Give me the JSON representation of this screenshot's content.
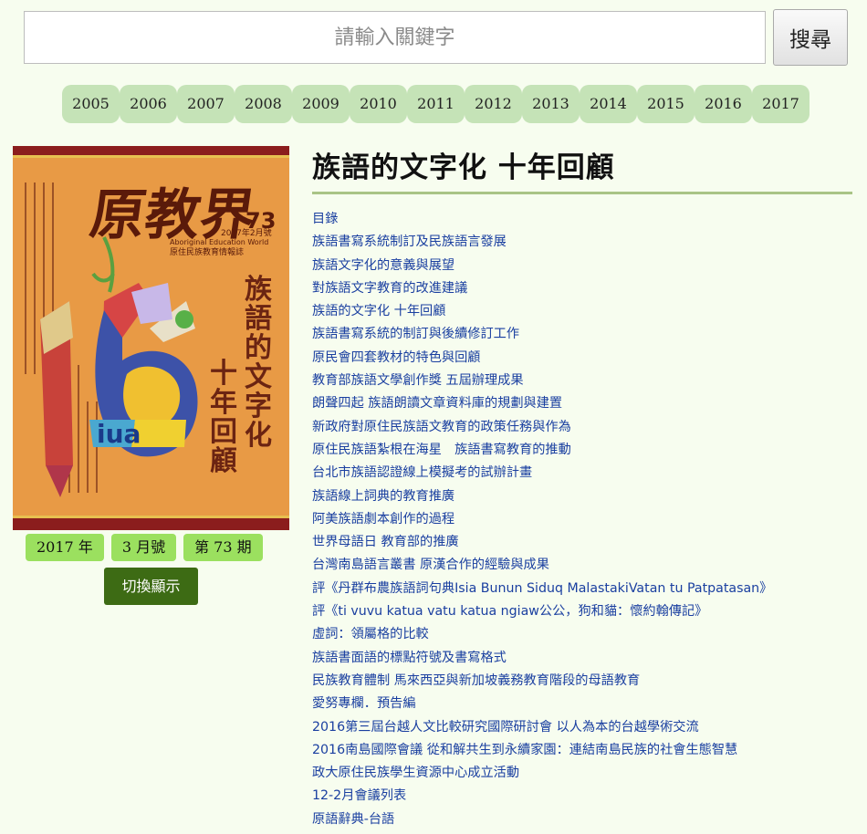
{
  "search": {
    "placeholder": "請輸入關鍵字",
    "button_label": "搜尋"
  },
  "years": [
    "2005",
    "2006",
    "2007",
    "2008",
    "2009",
    "2010",
    "2011",
    "2012",
    "2013",
    "2014",
    "2015",
    "2016",
    "2017"
  ],
  "issue": {
    "year_label": "2017 年",
    "month_label": "3 月號",
    "issue_label": "第 73 期",
    "toggle_label": "切換顯示"
  },
  "cover": {
    "logo_text": "原教界",
    "issue_number": "73",
    "date_text": "2017年2月號",
    "english_title": "Aboriginal Education World",
    "subtitle": "原住民族教育情報誌",
    "main_text_lines": [
      "族",
      "語",
      "的",
      "文",
      "字",
      "化",
      "十",
      "年",
      "回",
      "顧"
    ],
    "mosaic_text": "iua",
    "colors": {
      "background": "#e89a45",
      "border": "#8b1d1d",
      "text": "#6b2412"
    }
  },
  "article": {
    "title": "族語的文字化 十年回顧",
    "toc": [
      "目錄",
      "族語書寫系統制訂及民族語言發展",
      "族語文字化的意義與展望",
      "對族語文字教育的改進建議",
      "族語的文字化 十年回顧",
      "族語書寫系統的制訂與後續修訂工作",
      "原民會四套教材的特色與回顧",
      "教育部族語文學創作獎 五屆辦理成果",
      "朗聲四起 族語朗讀文章資料庫的規劃與建置",
      "新政府對原住民族語文教育的政策任務與作為",
      "原住民族語紮根在海星　族語書寫教育的推動",
      "台北市族語認證線上模擬考的試辦計畫",
      "族語線上詞典的教育推廣",
      "阿美族語劇本創作的過程",
      "世界母語日 教育部的推廣",
      "台灣南島語言叢書 原漢合作的經驗與成果",
      "評《丹群布農族語詞句典Isia Bunun Siduq MalastakiVatan tu Patpatasan》",
      "評《ti vuvu katua vatu katua ngiaw公公，狗和貓：懷約翰傳記》",
      "虛詞：領屬格的比較",
      "族語書面語的標點符號及書寫格式",
      "民族教育體制 馬來西亞與新加坡義務教育階段的母語教育",
      "愛努專欄．預告編",
      "2016第三屆台越人文比較研究國際研討會 以人為本的台越學術交流",
      "2016南島國際會議 從和解共生到永續家園：連結南島民族的社會生態智慧",
      "政大原住民族學生資源中心成立活動",
      "12-2月會議列表",
      "原語辭典-台語"
    ]
  },
  "colors": {
    "page_bg": "#f7fdef",
    "year_pill": "#c5e3b7",
    "tag": "#9be05f",
    "toggle": "#3d6b14",
    "link": "#1a3fa0",
    "rule": "#a9c486"
  }
}
